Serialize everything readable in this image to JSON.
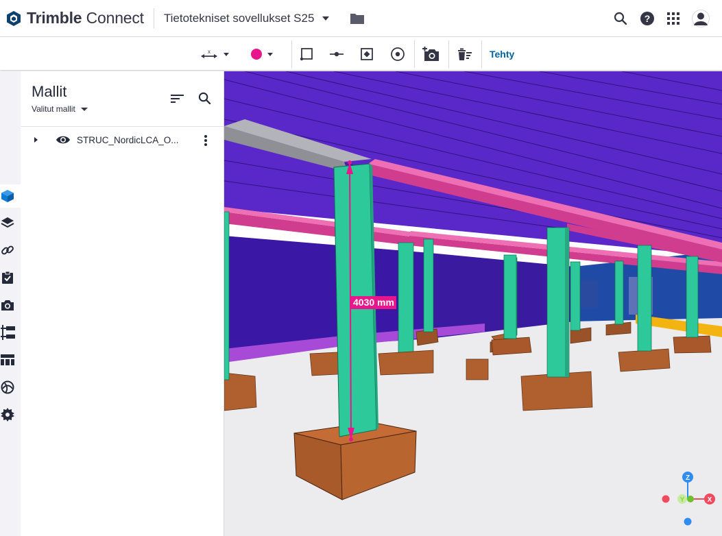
{
  "header": {
    "brand_bold": "Trimble",
    "brand_light": "Connect",
    "project_name": "Tietotekniset sovellukset S25",
    "icons": [
      "trimble-logo-icon",
      "chevron-down-icon",
      "folder-icon",
      "search-icon",
      "help-icon",
      "apps-grid-icon",
      "user-avatar-icon"
    ]
  },
  "toolbar": {
    "measure_icon": "measure-axis-icon",
    "color_value": "#e8168c",
    "tools": [
      "select-face-icon",
      "point-on-line-icon",
      "point-in-box-icon",
      "center-point-icon",
      "add-snapshot-icon",
      "clear-measurements-icon"
    ],
    "done_label": "Tehty"
  },
  "rail": {
    "items": [
      "models-cube-icon",
      "layers-icon",
      "links-icon",
      "todo-clipboard-icon",
      "views-camera-icon",
      "organizer-tree-icon",
      "properties-table-icon",
      "explorer-globe-icon",
      "extensions-gear-icon"
    ],
    "active_index": 0,
    "accent_color": "#0b7bd6"
  },
  "panel": {
    "title": "Mallit",
    "filter_label": "Valitut mallit",
    "models": [
      {
        "name": "STRUC_NordicLCA_O...",
        "visible": true
      }
    ]
  },
  "viewport": {
    "measurement": "4030 mm",
    "measurement_color": "#e8168c",
    "axes": {
      "z": "Z",
      "x": "X",
      "y": "Y"
    },
    "colors": {
      "ceiling": "#4a1fb0",
      "walls": "#3a1aa8",
      "columns": "#2ec99a",
      "beams": "#d8418f",
      "footings": "#b0602e",
      "floor": "#ececee"
    }
  }
}
